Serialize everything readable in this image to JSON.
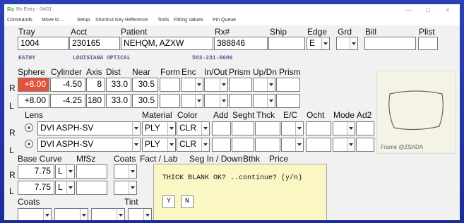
{
  "titlebar": {
    "title": "Rx Entry - 04/01",
    "minimize": "—",
    "maximize": "□",
    "close": "×"
  },
  "menu": [
    "Commands",
    "Move to ...",
    "Setup",
    "Shortcut Key Reference",
    "Tools",
    "Fitting Values",
    "Pin Queue"
  ],
  "header": {
    "labels": {
      "tray": "Tray",
      "acct": "Acct",
      "patient": "Patient",
      "rx": "Rx#",
      "ship": "Ship",
      "edge": "Edge",
      "grd": "Grd",
      "bill": "Bill",
      "plist": "Plist"
    },
    "values": {
      "tray": "1004",
      "acct": "230165",
      "patient": "NEHQM, AZXW",
      "rx": "388846",
      "ship": "",
      "edge": "E",
      "grd": "",
      "bill": "",
      "plist": ""
    }
  },
  "account_info": {
    "name": "KATHY",
    "lab": "LOUISIANA OPTICAL",
    "phone": "503-231-6606"
  },
  "rx": {
    "labels": {
      "sphere": "Sphere",
      "cylinder": "Cylinder",
      "axis": "Axis",
      "dist": "Dist",
      "near": "Near",
      "form": "Form",
      "enc": "Enc",
      "inout": "In/Out",
      "prism": "Prism",
      "updn": "Up/Dn",
      "prism2": "Prism"
    },
    "eyes": {
      "right": "R",
      "left": "L"
    },
    "right": {
      "sphere": "+8.00",
      "cylinder": "-4.50",
      "axis": "8",
      "dist": "33.0",
      "near": "30.5"
    },
    "left": {
      "sphere": "+8.00",
      "cylinder": "-4.25",
      "axis": "180",
      "dist": "33.0",
      "near": "30.5"
    }
  },
  "lens": {
    "labels": {
      "lens": "Lens",
      "material": "Material",
      "color": "Color",
      "add": "Add",
      "seght": "Seght",
      "thck": "Thck",
      "ec": "E/C",
      "ocht": "Ocht",
      "mode": "Mode",
      "ad2": "Ad2"
    },
    "right": {
      "lens": "DVI ASPH-SV",
      "material": "PLY",
      "color": "CLR"
    },
    "left": {
      "lens": "DVI ASPH-SV",
      "material": "PLY",
      "color": "CLR"
    }
  },
  "base": {
    "labels": {
      "base_curve": "Base Curve",
      "mfsz": "MfSz",
      "coats": "Coats",
      "factlab": "Fact / Lab",
      "seg": "Seg In / Down",
      "bthk": "Bthk",
      "price": "Price"
    },
    "right": {
      "value": "7.75",
      "mode": "L"
    },
    "left": {
      "value": "7.75",
      "mode": "L"
    }
  },
  "coats_row": {
    "coats": "Coats",
    "tint": "Tint"
  },
  "frame_preview": {
    "label": "Frame @ZSADA"
  },
  "dialog": {
    "message": "THICK BLANK OK? ..continue? (y/n)",
    "yes": "Y",
    "no": "N"
  },
  "colors": {
    "desktop": "#2233a8",
    "sphere_highlight": "#e2523c",
    "dialog_bg": "#fbf7c4"
  }
}
